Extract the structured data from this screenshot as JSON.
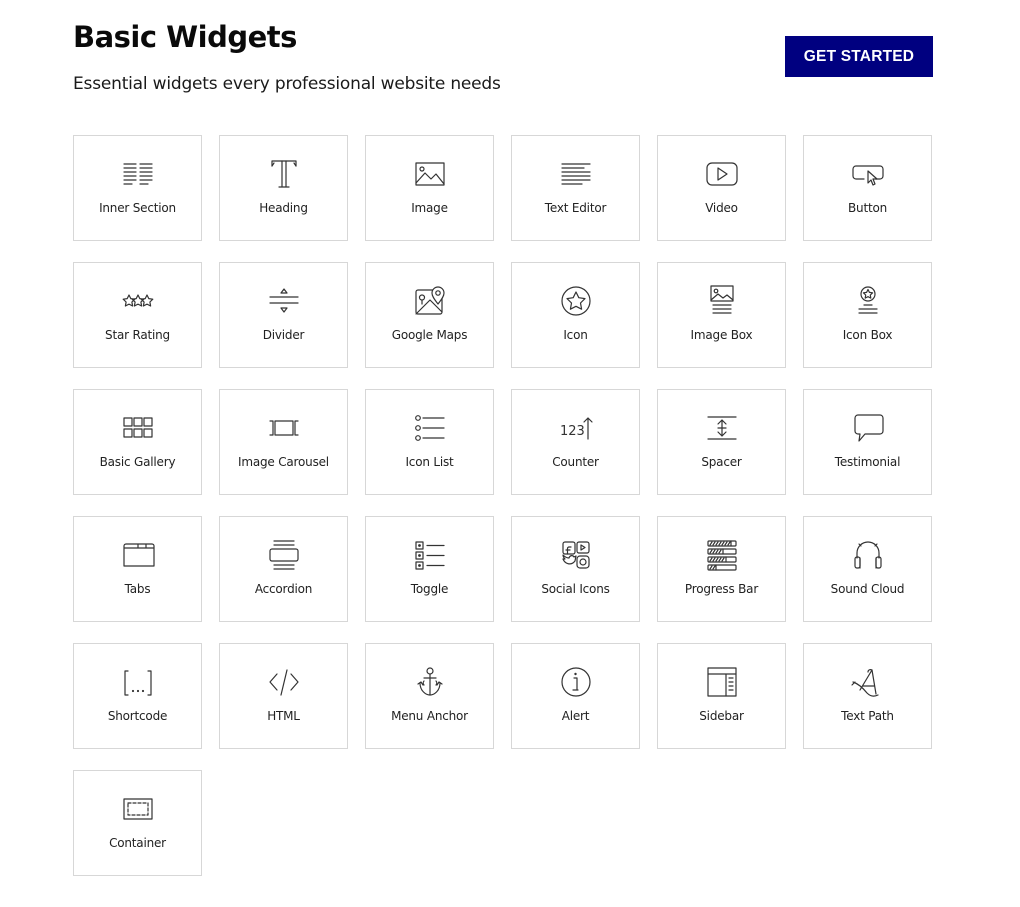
{
  "header": {
    "title": "Basic Widgets",
    "subtitle": "Essential widgets every professional website needs",
    "cta_label": "GET STARTED",
    "cta_color": "#000080"
  },
  "widgets": [
    {
      "label": "Inner Section",
      "icon": "inner-section-icon"
    },
    {
      "label": "Heading",
      "icon": "heading-icon"
    },
    {
      "label": "Image",
      "icon": "image-icon"
    },
    {
      "label": "Text Editor",
      "icon": "text-editor-icon"
    },
    {
      "label": "Video",
      "icon": "video-icon"
    },
    {
      "label": "Button",
      "icon": "button-icon"
    },
    {
      "label": "Star Rating",
      "icon": "star-rating-icon"
    },
    {
      "label": "Divider",
      "icon": "divider-icon"
    },
    {
      "label": "Google Maps",
      "icon": "google-maps-icon"
    },
    {
      "label": "Icon",
      "icon": "star-circle-icon"
    },
    {
      "label": "Image Box",
      "icon": "image-box-icon"
    },
    {
      "label": "Icon Box",
      "icon": "icon-box-icon"
    },
    {
      "label": "Basic Gallery",
      "icon": "gallery-icon"
    },
    {
      "label": "Image Carousel",
      "icon": "carousel-icon"
    },
    {
      "label": "Icon List",
      "icon": "icon-list-icon"
    },
    {
      "label": "Counter",
      "icon": "counter-icon"
    },
    {
      "label": "Spacer",
      "icon": "spacer-icon"
    },
    {
      "label": "Testimonial",
      "icon": "speech-bubble-icon"
    },
    {
      "label": "Tabs",
      "icon": "tabs-icon"
    },
    {
      "label": "Accordion",
      "icon": "accordion-icon"
    },
    {
      "label": "Toggle",
      "icon": "toggle-icon"
    },
    {
      "label": "Social Icons",
      "icon": "social-icons-icon"
    },
    {
      "label": "Progress Bar",
      "icon": "progress-bar-icon"
    },
    {
      "label": "Sound Cloud",
      "icon": "headphones-icon"
    },
    {
      "label": "Shortcode",
      "icon": "shortcode-icon"
    },
    {
      "label": "HTML",
      "icon": "code-icon"
    },
    {
      "label": "Menu Anchor",
      "icon": "anchor-icon"
    },
    {
      "label": "Alert",
      "icon": "info-icon"
    },
    {
      "label": "Sidebar",
      "icon": "sidebar-icon"
    },
    {
      "label": "Text Path",
      "icon": "text-path-icon"
    },
    {
      "label": "Container",
      "icon": "container-icon"
    }
  ]
}
